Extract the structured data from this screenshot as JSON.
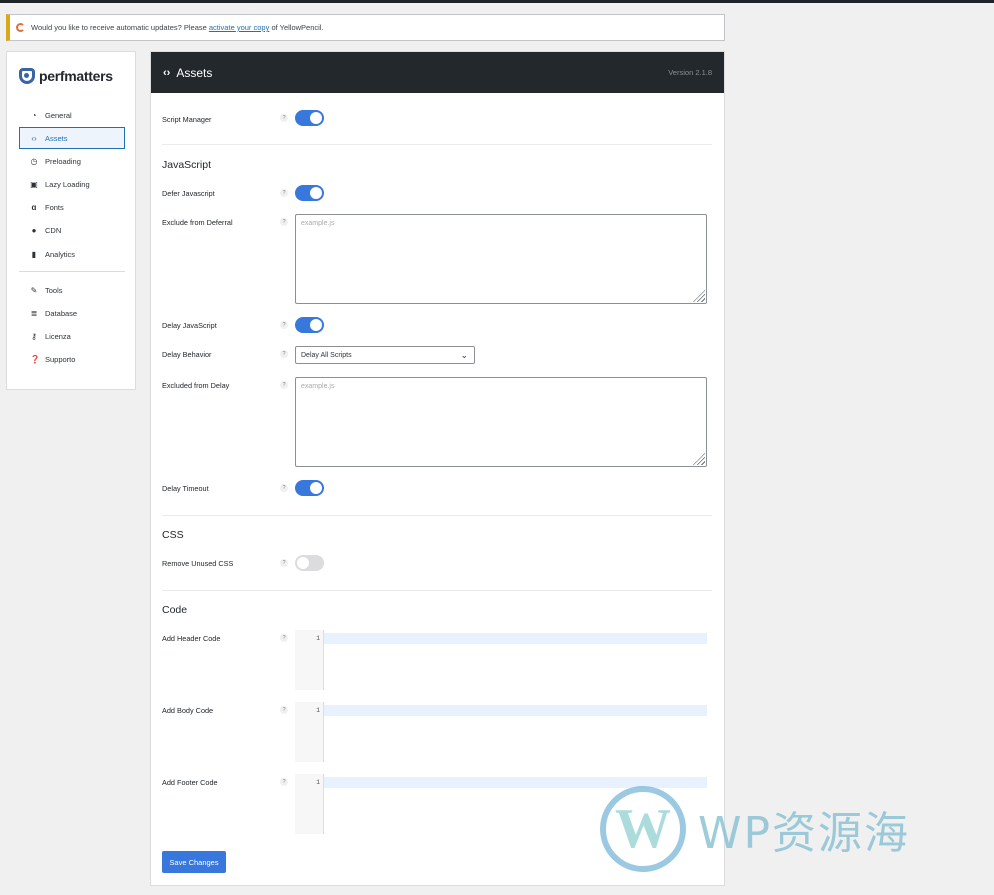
{
  "notice": {
    "text_before": "Would you like to receive automatic updates? Please",
    "link": "activate your copy",
    "text_after": "of YellowPencil."
  },
  "brand": {
    "name": "perfmatters"
  },
  "sidebar": {
    "items": [
      {
        "label": "General",
        "icon": "dashboard-icon"
      },
      {
        "label": "Assets",
        "icon": "code-icon"
      },
      {
        "label": "Preloading",
        "icon": "clock-icon"
      },
      {
        "label": "Lazy Loading",
        "icon": "image-icon"
      },
      {
        "label": "Fonts",
        "icon": "font-icon"
      },
      {
        "label": "CDN",
        "icon": "globe-icon"
      },
      {
        "label": "Analytics",
        "icon": "bar-chart-icon"
      }
    ],
    "items2": [
      {
        "label": "Tools",
        "icon": "wrench-icon"
      },
      {
        "label": "Database",
        "icon": "database-icon"
      },
      {
        "label": "Licenza",
        "icon": "key-icon"
      },
      {
        "label": "Supporto",
        "icon": "question-icon"
      }
    ]
  },
  "header": {
    "title": "Assets",
    "version": "Version 2.1.8"
  },
  "help_glyph": "?",
  "fields": {
    "script_manager": "Script Manager",
    "javascript_title": "JavaScript",
    "defer_javascript": "Defer Javascript",
    "exclude_from_deferral": "Exclude from Deferral",
    "exclude_placeholder": "example.js",
    "delay_javascript": "Delay JavaScript",
    "delay_behavior": "Delay Behavior",
    "delay_behavior_value": "Delay All Scripts",
    "excluded_from_delay": "Excluded from Delay",
    "excluded_delay_placeholder": "example.js",
    "delay_timeout": "Delay Timeout",
    "css_title": "CSS",
    "remove_unused_css": "Remove Unused CSS",
    "code_title": "Code",
    "add_header_code": "Add Header Code",
    "add_body_code": "Add Body Code",
    "add_footer_code": "Add Footer Code",
    "line_number": "1"
  },
  "toggles": {
    "script_manager": true,
    "defer_javascript": true,
    "delay_javascript": true,
    "delay_timeout": true,
    "remove_unused_css": false
  },
  "save_label": "Save Changes",
  "watermark": {
    "logo": "W",
    "text": "WP资源海"
  }
}
